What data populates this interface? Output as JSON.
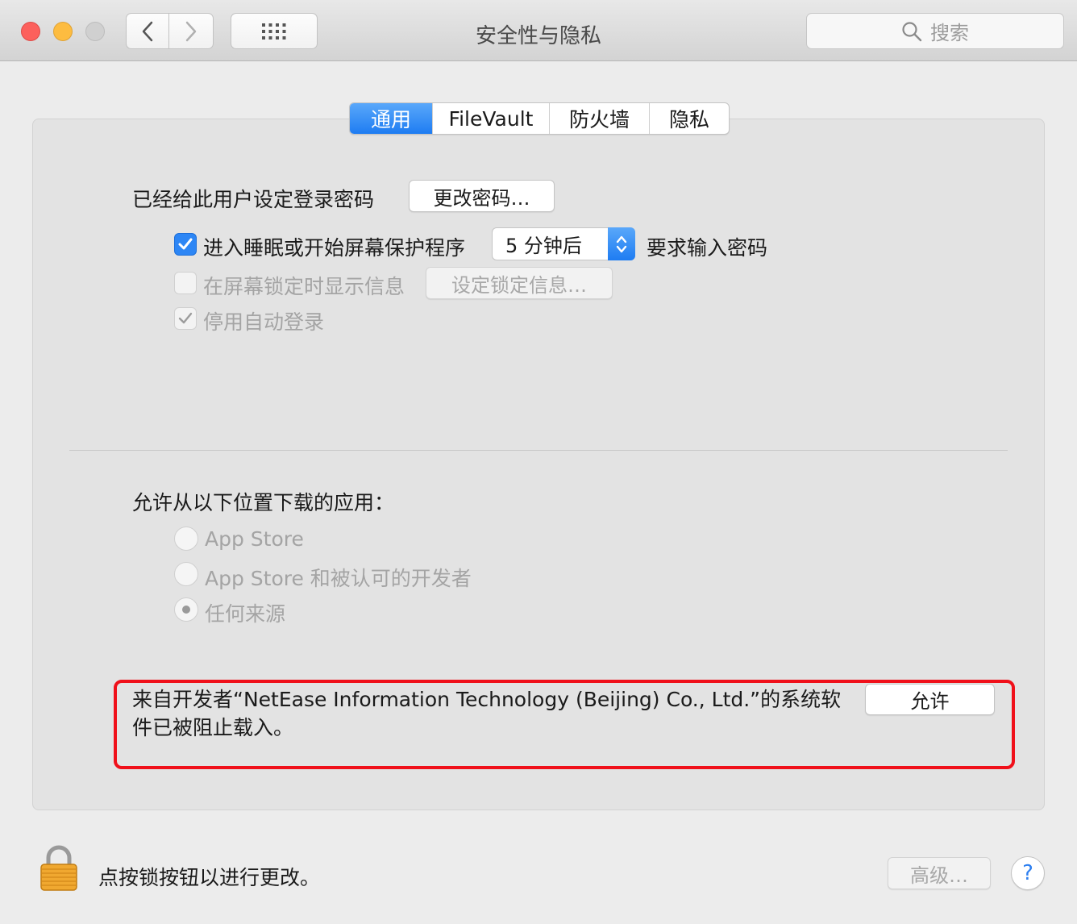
{
  "window": {
    "title": "安全性与隐私"
  },
  "search": {
    "placeholder": "搜索"
  },
  "tabs": [
    {
      "label": "通用",
      "active": true
    },
    {
      "label": "FileVault",
      "active": false
    },
    {
      "label": "防火墙",
      "active": false
    },
    {
      "label": "隐私",
      "active": false
    }
  ],
  "general": {
    "password_set_label": "已经给此用户设定登录密码",
    "change_password_button": "更改密码…",
    "require_password": {
      "label": "进入睡眠或开始屏幕保护程序",
      "checked": true,
      "delay_value": "5 分钟后",
      "suffix": "要求输入密码"
    },
    "show_message": {
      "label": "在屏幕锁定时显示信息",
      "checked": false,
      "button": "设定锁定信息…"
    },
    "disable_auto_login": {
      "label": "停用自动登录",
      "checked": true
    }
  },
  "downloads": {
    "heading": "允许从以下位置下载的应用：",
    "options": [
      {
        "label": "App Store",
        "selected": false
      },
      {
        "label": "App Store 和被认可的开发者",
        "selected": false
      },
      {
        "label": "任何来源",
        "selected": true
      }
    ]
  },
  "blocked": {
    "message": "来自开发者“NetEase Information Technology (Beijing) Co., Ltd.”的系统软件已被阻止载入。",
    "allow_button": "允许"
  },
  "footer": {
    "lock_text": "点按锁按钮以进行更改。",
    "advanced_button": "高级…",
    "help_label": "?"
  },
  "colors": {
    "accent": "#1e7cf2",
    "highlight_border": "#f0101a"
  }
}
